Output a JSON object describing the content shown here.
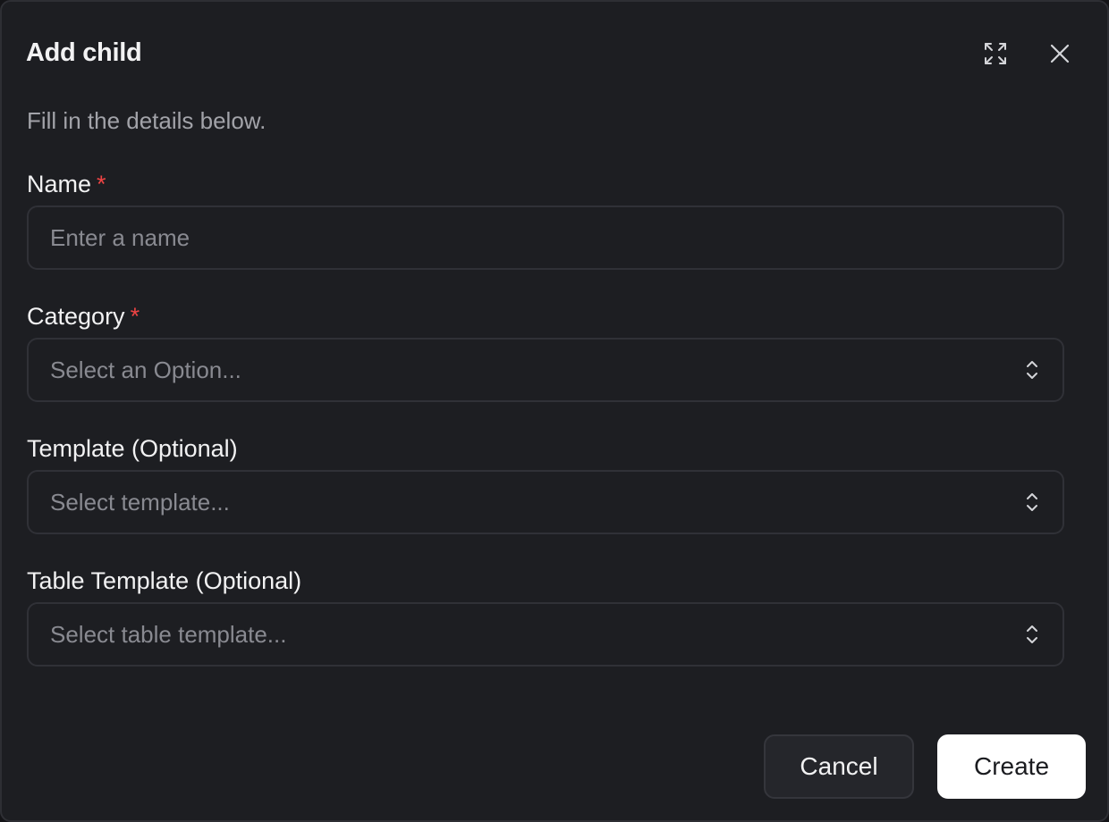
{
  "dialog": {
    "title": "Add child",
    "subtitle": "Fill in the details below.",
    "expand_icon": "expand-icon",
    "close_icon": "close-icon"
  },
  "fields": {
    "name": {
      "label": "Name",
      "required_marker": "*",
      "placeholder": "Enter a name",
      "value": ""
    },
    "category": {
      "label": "Category",
      "required_marker": "*",
      "placeholder": "Select an Option...",
      "icon": "chevron-up-down-icon"
    },
    "template": {
      "label": "Template (Optional)",
      "placeholder": "Select template...",
      "icon": "chevron-up-down-icon"
    },
    "table_template": {
      "label": "Table Template (Optional)",
      "placeholder": "Select table template...",
      "icon": "chevron-up-down-icon"
    }
  },
  "actions": {
    "cancel_label": "Cancel",
    "create_label": "Create"
  },
  "colors": {
    "background": "#1d1e22",
    "border": "#303137",
    "required": "#ef4444",
    "primary_button": "#ffffff"
  }
}
